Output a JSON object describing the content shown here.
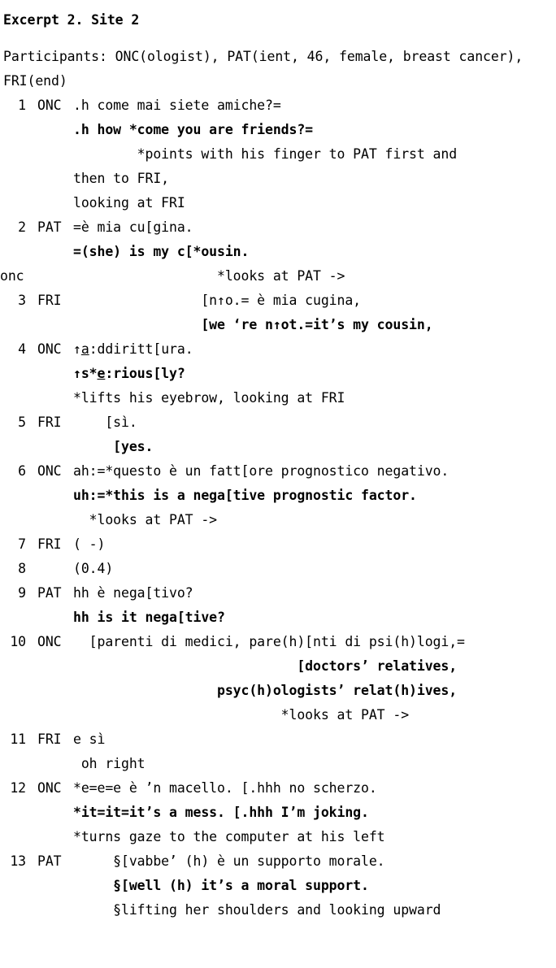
{
  "title": "Excerpt 2. Site 2",
  "participants": "Participants: ONC(ologist), PAT(ient, 46, female, breast cancer), FRI(end)",
  "lines": [
    {
      "num": "1",
      "spk": "ONC",
      "text": ".h come mai siete amiche?=",
      "style": "plain",
      "indent": 0
    },
    {
      "num": "",
      "spk": "",
      "text": ".h how *come you are friends?=",
      "style": "bold",
      "indent": 0
    },
    {
      "num": "",
      "spk": "",
      "text": "        *points with his finger to PAT first and",
      "style": "plain",
      "indent": 0
    },
    {
      "num": "",
      "spk": "",
      "text": "then to FRI,",
      "style": "plain",
      "indent": 0
    },
    {
      "num": "",
      "spk": "",
      "text": "looking at FRI",
      "style": "plain",
      "indent": 0
    },
    {
      "num": "2",
      "spk": "PAT",
      "text": "=è mia cu[gina.",
      "style": "plain",
      "indent": 0
    },
    {
      "num": "",
      "spk": "",
      "text": "=(she) is my c[*ousin.",
      "style": "bold",
      "indent": 0
    },
    {
      "num": "onc",
      "spk": "",
      "text": "                  *looks at PAT ->",
      "style": "marker",
      "indent": 0
    },
    {
      "num": "3",
      "spk": "FRI",
      "text": "                [n↑o.= è mia cugina,",
      "style": "plain",
      "indent": 0
    },
    {
      "num": "",
      "spk": "",
      "text": "                [we ‘re n↑ot.=it’s my cousin,",
      "style": "bold",
      "indent": 0
    },
    {
      "num": "4",
      "spk": "ONC",
      "text": "↑a:ddiritt[ura.",
      "style": "plain-u-a",
      "indent": 0
    },
    {
      "num": "",
      "spk": "",
      "text": "↑s*e:rious[ly?",
      "style": "bold-u-e",
      "indent": 0
    },
    {
      "num": "",
      "spk": "",
      "text": "*lifts his eyebrow, looking at FRI",
      "style": "plain",
      "indent": 0
    },
    {
      "num": "5",
      "spk": "FRI",
      "text": "    [sì.",
      "style": "plain",
      "indent": 0
    },
    {
      "num": "",
      "spk": "",
      "text": "     [yes.",
      "style": "bold",
      "indent": 0
    },
    {
      "num": "6",
      "spk": "ONC",
      "text": "ah:=*questo è un fatt[ore prognostico negativo.",
      "style": "plain",
      "indent": 0
    },
    {
      "num": "",
      "spk": "",
      "text": "uh:=*this is a nega[tive prognostic factor.",
      "style": "bold",
      "indent": 0
    },
    {
      "num": "",
      "spk": "",
      "text": "  *looks at PAT ->",
      "style": "plain",
      "indent": 0
    },
    {
      "num": "7",
      "spk": "FRI",
      "text": "( -)",
      "style": "plain",
      "indent": 0
    },
    {
      "num": "8",
      "spk": "",
      "text": "(0.4)",
      "style": "plain",
      "indent": 0
    },
    {
      "num": "9",
      "spk": "PAT",
      "text": "hh è nega[tivo?",
      "style": "plain",
      "indent": 0
    },
    {
      "num": "",
      "spk": "",
      "text": "hh is it nega[tive?",
      "style": "bold",
      "indent": 0
    },
    {
      "num": "10",
      "spk": "ONC",
      "text": "  [parenti di medici, pare(h)[nti di psi(h)logi,=",
      "style": "plain",
      "indent": 0
    },
    {
      "num": "",
      "spk": "",
      "text": "                            [doctors’ relatives,",
      "style": "bold",
      "indent": 0
    },
    {
      "num": "",
      "spk": "",
      "text": "                  psyc(h)ologists’ relat(h)ives,",
      "style": "bold",
      "indent": 0
    },
    {
      "num": "",
      "spk": "",
      "text": "                          *looks at PAT ->",
      "style": "plain",
      "indent": 0
    },
    {
      "num": "11",
      "spk": "FRI",
      "text": "e sì",
      "style": "plain",
      "indent": 0
    },
    {
      "num": "",
      "spk": "",
      "text": " oh right",
      "style": "plain",
      "indent": 0
    },
    {
      "num": "12",
      "spk": "ONC",
      "text": "*e=e=e è ’n macello. [.hhh no scherzo.",
      "style": "plain",
      "indent": 0
    },
    {
      "num": "",
      "spk": "",
      "text": "*it=it=it’s a mess. [.hhh I’m joking.",
      "style": "bold",
      "indent": 0
    },
    {
      "num": "",
      "spk": "",
      "text": "*turns gaze to the computer at his left",
      "style": "plain",
      "indent": 0
    },
    {
      "num": "13",
      "spk": "PAT",
      "text": "     §[vabbe’ (h) è un supporto morale.",
      "style": "plain",
      "indent": 0
    },
    {
      "num": "",
      "spk": "",
      "text": "     §[well (h) it’s a moral support.",
      "style": "bold",
      "indent": 0
    },
    {
      "num": "",
      "spk": "",
      "text": "     §lifting her shoulders and looking upward",
      "style": "plain",
      "indent": 0
    }
  ]
}
